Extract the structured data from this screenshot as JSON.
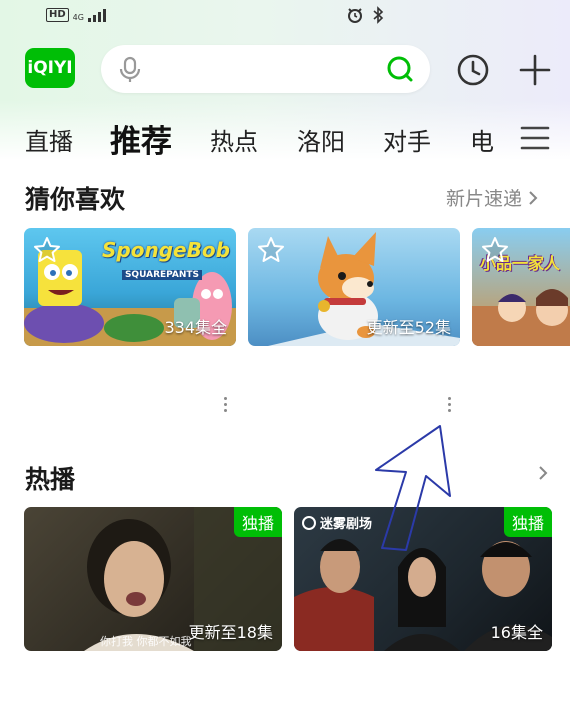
{
  "status_bar": {
    "hd": "HD",
    "network": "4G"
  },
  "header": {
    "logo_text": "iQIYI"
  },
  "tabs": [
    {
      "label": "直播"
    },
    {
      "label": "推荐",
      "active": true
    },
    {
      "label": "热点"
    },
    {
      "label": "洛阳"
    },
    {
      "label": "对手"
    },
    {
      "label": "电"
    }
  ],
  "guess_section": {
    "title": "猜你喜欢",
    "more_label": "新片速递"
  },
  "guess_cards": [
    {
      "logo": "SpongeBob",
      "logo_sub": "SQUAREPANTS",
      "badge": "334集全"
    },
    {
      "badge": "更新至52集"
    },
    {
      "logo": "小品一家人"
    }
  ],
  "hot_section": {
    "title": "热播"
  },
  "hot_cards": [
    {
      "tag": "独播",
      "badge": "更新至18集",
      "subtitle": "你打我 你都不如我"
    },
    {
      "tag": "独播",
      "badge": "16集全",
      "studio": "迷雾剧场"
    }
  ],
  "colors": {
    "brand": "#00be06",
    "text_muted": "#888888",
    "arrow": "#2b3aa8"
  }
}
